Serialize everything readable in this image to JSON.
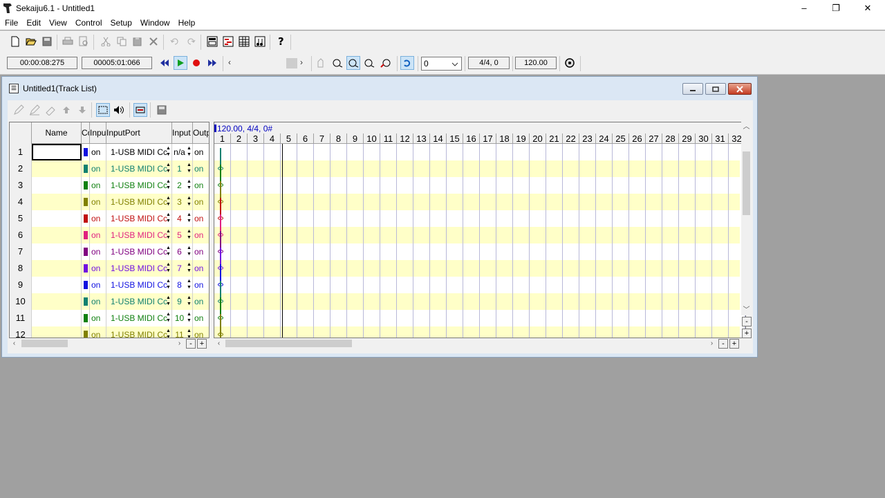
{
  "app": {
    "title": "Sekaiju6.1 - Untitled1",
    "window_controls": {
      "minimize": "–",
      "restore": "❐",
      "close": "✕"
    }
  },
  "menu": [
    "File",
    "Edit",
    "View",
    "Control",
    "Setup",
    "Window",
    "Help"
  ],
  "transport": {
    "time": "00:00:08:275",
    "measure": "00005:01:066",
    "dropdown_value": "0",
    "beat": "4/4, 0",
    "tempo": "120.00"
  },
  "child_window": {
    "title": "Untitled1(Track List)"
  },
  "track_list": {
    "headers": {
      "name": "Name",
      "color": "Co",
      "input": "Inpu",
      "input_port": "InputPort",
      "input_ch": "Input",
      "output": "Outp"
    },
    "rows": [
      {
        "num": "1",
        "name": "",
        "color": "#1010e0",
        "input": "on",
        "port": "1-USB MIDI Cc",
        "ch": "n/a",
        "out": "on",
        "text_color": "#000000"
      },
      {
        "num": "2",
        "name": "",
        "color": "#108070",
        "input": "on",
        "port": "1-USB MIDI Cc",
        "ch": "1",
        "out": "on",
        "text_color": "#108070"
      },
      {
        "num": "3",
        "name": "",
        "color": "#108010",
        "input": "on",
        "port": "1-USB MIDI Cc",
        "ch": "2",
        "out": "on",
        "text_color": "#108010"
      },
      {
        "num": "4",
        "name": "",
        "color": "#808000",
        "input": "on",
        "port": "1-USB MIDI Cc",
        "ch": "3",
        "out": "on",
        "text_color": "#808000"
      },
      {
        "num": "5",
        "name": "",
        "color": "#c01010",
        "input": "on",
        "port": "1-USB MIDI Cc",
        "ch": "4",
        "out": "on",
        "text_color": "#c01010"
      },
      {
        "num": "6",
        "name": "",
        "color": "#e02080",
        "input": "on",
        "port": "1-USB MIDI Cc",
        "ch": "5",
        "out": "on",
        "text_color": "#e02080"
      },
      {
        "num": "7",
        "name": "",
        "color": "#800080",
        "input": "on",
        "port": "1-USB MIDI Cc",
        "ch": "6",
        "out": "on",
        "text_color": "#800080"
      },
      {
        "num": "8",
        "name": "",
        "color": "#7010e0",
        "input": "on",
        "port": "1-USB MIDI Cc",
        "ch": "7",
        "out": "on",
        "text_color": "#7010e0"
      },
      {
        "num": "9",
        "name": "",
        "color": "#1010e0",
        "input": "on",
        "port": "1-USB MIDI Cc",
        "ch": "8",
        "out": "on",
        "text_color": "#1010e0"
      },
      {
        "num": "10",
        "name": "",
        "color": "#108070",
        "input": "on",
        "port": "1-USB MIDI Cc",
        "ch": "9",
        "out": "on",
        "text_color": "#108070"
      },
      {
        "num": "11",
        "name": "",
        "color": "#108010",
        "input": "on",
        "port": "1-USB MIDI Cc",
        "ch": "10",
        "out": "on",
        "text_color": "#108010"
      },
      {
        "num": "12",
        "name": "",
        "color": "#808000",
        "input": "on",
        "port": "1-USB MIDI Cc",
        "ch": "11",
        "out": "on",
        "text_color": "#808000"
      }
    ]
  },
  "ruler": {
    "tempo_label": "120.00, 4/4, 0#",
    "measures": [
      "1",
      "2",
      "3",
      "4",
      "5",
      "6",
      "7",
      "8",
      "9",
      "10",
      "11",
      "12",
      "13",
      "14",
      "15",
      "16",
      "17",
      "18",
      "19",
      "20",
      "21",
      "22",
      "23",
      "24",
      "25",
      "26",
      "27",
      "28",
      "29",
      "30",
      "31",
      "32"
    ]
  },
  "scroll": {
    "minus": "-",
    "plus": "+"
  }
}
